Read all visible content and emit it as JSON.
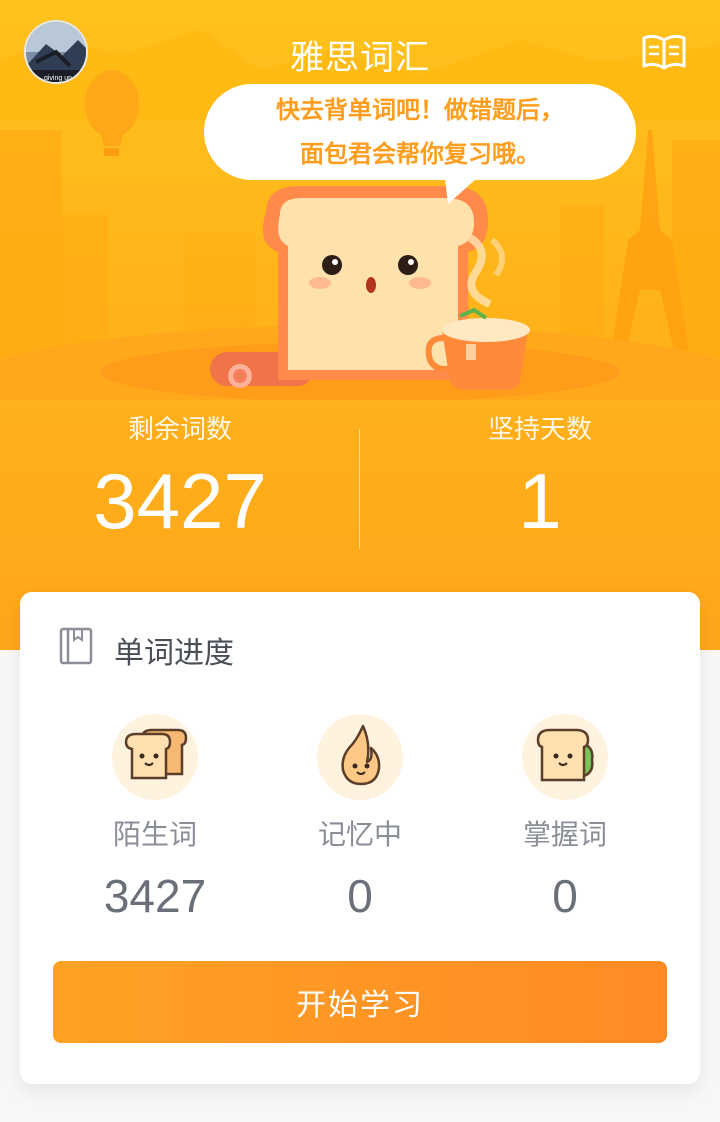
{
  "header": {
    "title": "雅思词汇",
    "avatar_text": "giving up"
  },
  "bubble": {
    "line1": "快去背单词吧！做错题后，",
    "line2": "面包君会帮你复习哦。"
  },
  "stats": {
    "remaining_label": "剩余词数",
    "remaining_value": "3427",
    "days_label": "坚持天数",
    "days_value": "1"
  },
  "progress": {
    "title": "单词进度",
    "items": [
      {
        "label": "陌生词",
        "value": "3427",
        "icon": "bread-slices-icon"
      },
      {
        "label": "记忆中",
        "value": "0",
        "icon": "flame-bread-icon"
      },
      {
        "label": "掌握词",
        "value": "0",
        "icon": "sandwich-icon"
      }
    ],
    "start_label": "开始学习"
  },
  "colors": {
    "hero": "#ffb41a",
    "accent": "#ff9e1e",
    "button": "#ff8a24"
  }
}
